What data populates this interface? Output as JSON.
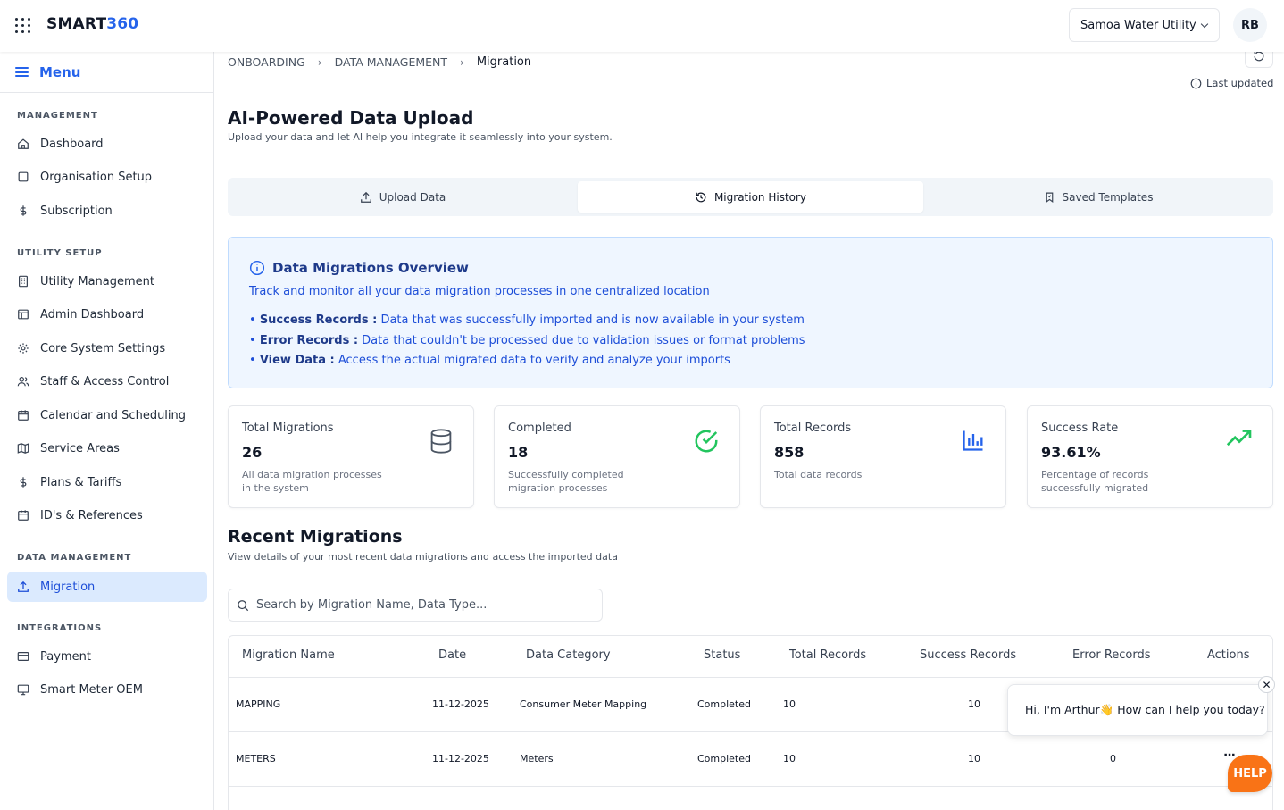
{
  "header": {
    "logo_main": "SMART",
    "logo_accent": "360",
    "org_name": "Samoa Water Utility",
    "avatar_initials": "RB"
  },
  "sidebar": {
    "menu_label": "Menu",
    "sections": {
      "management": "MANAGEMENT",
      "utility_setup": "UTILITY SETUP",
      "data_management": "DATA MANAGEMENT",
      "integrations": "INTEGRATIONS"
    },
    "items": {
      "dashboard": "Dashboard",
      "organisation_setup": "Organisation Setup",
      "subscription": "Subscription",
      "utility_management": "Utility Management",
      "admin_dashboard": "Admin Dashboard",
      "core_system_settings": "Core System Settings",
      "staff_access_control": "Staff & Access Control",
      "calendar_scheduling": "Calendar and Scheduling",
      "service_areas": "Service Areas",
      "plans_tariffs": "Plans & Tariffs",
      "ids_references": "ID's & References",
      "migration": "Migration",
      "payment": "Payment",
      "smart_meter_oem": "Smart Meter OEM"
    }
  },
  "breadcrumb": [
    "ONBOARDING",
    "DATA MANAGEMENT",
    "Migration"
  ],
  "last_updated_label": "Last updated",
  "page": {
    "title": "AI-Powered Data Upload",
    "subtitle": "Upload your data and let AI help you integrate it seamlessly into your system."
  },
  "tabs": {
    "upload": "Upload Data",
    "history": "Migration History",
    "templates": "Saved Templates"
  },
  "overview": {
    "title": "Data Migrations Overview",
    "subtitle": "Track and monitor all your data migration processes in one centralized location",
    "items": [
      {
        "term": "Success Records :",
        "desc": "Data that was successfully imported and is now available in your system"
      },
      {
        "term": "Error Records :",
        "desc": "Data that couldn't be processed due to validation issues or format problems"
      },
      {
        "term": "View Data :",
        "desc": "Access the actual migrated data to verify and analyze your imports"
      }
    ]
  },
  "stats": [
    {
      "title": "Total Migrations",
      "value": "26",
      "desc": "All data migration processes in the system"
    },
    {
      "title": "Completed",
      "value": "18",
      "desc": "Successfully completed migration processes"
    },
    {
      "title": "Total Records",
      "value": "858",
      "desc": "Total data records"
    },
    {
      "title": "Success Rate",
      "value": "93.61%",
      "desc": "Percentage of records successfully migrated"
    }
  ],
  "colors": {
    "primary": "#2563eb",
    "success": "#22c55e",
    "help": "#f97316"
  },
  "recent": {
    "title": "Recent Migrations",
    "subtitle": "View details of your most recent data migrations and access the imported data",
    "search_placeholder": "Search by Migration Name, Data Type..."
  },
  "table": {
    "columns": [
      "Migration Name",
      "Date",
      "Data Category",
      "Status",
      "Total Records",
      "Success Records",
      "Error Records",
      "Actions"
    ],
    "rows": [
      {
        "name": "MAPPING",
        "date": "11-12-2025",
        "category": "Consumer Meter Mapping",
        "status": "Completed",
        "total": "10",
        "success": "10",
        "error": ""
      },
      {
        "name": "METERS",
        "date": "11-12-2025",
        "category": "Meters",
        "status": "Completed",
        "total": "10",
        "success": "10",
        "error": "0"
      }
    ]
  },
  "chat": {
    "message": "Hi, I'm Arthur👋 How can I help you today?",
    "close": "✕",
    "help_label": "HELP"
  }
}
